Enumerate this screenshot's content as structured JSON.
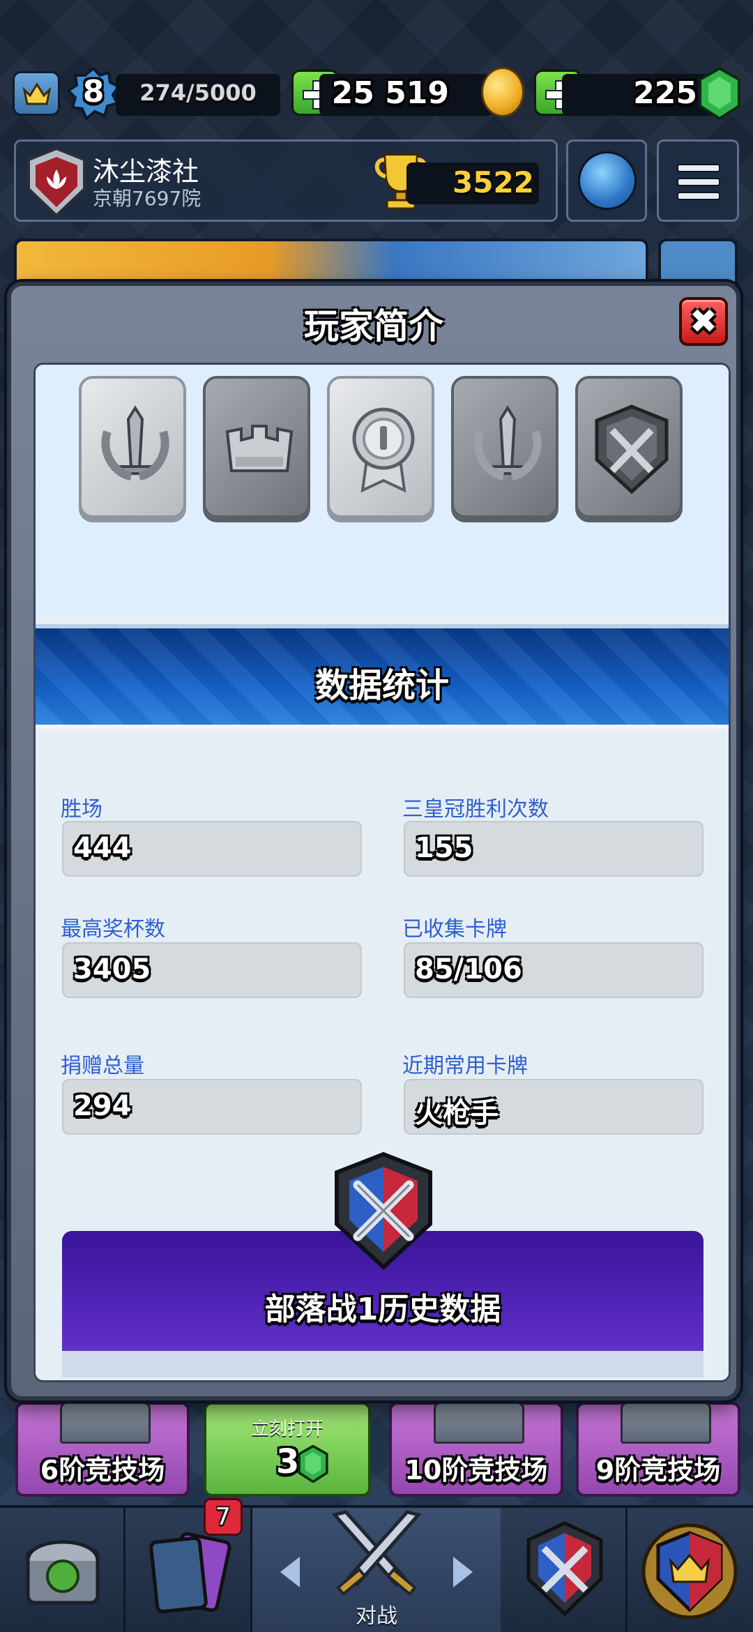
{
  "topbar": {
    "level": "8",
    "xp": "274/5000",
    "gold": "25 519",
    "gems": "225"
  },
  "clan": {
    "name": "沐尘漆社",
    "subtitle": "京朝7697院",
    "trophies": "3522"
  },
  "modal": {
    "title": "玩家简介",
    "close_label": "✖",
    "badges": [
      "sword-laurel-badge",
      "crown-badge",
      "medal-badge",
      "sword-laurel-badge",
      "clan-war-shield-badge"
    ],
    "section_title": "数据统计",
    "stats": {
      "wins_label": "胜场",
      "wins_value": "444",
      "three_crown_label": "三皇冠胜利次数",
      "three_crown_value": "155",
      "best_trophies_label": "最高奖杯数",
      "best_trophies_value": "3405",
      "cards_found_label": "已收集卡牌",
      "cards_found_value": "85/106",
      "donations_label": "捐赠总量",
      "donations_value": "294",
      "favorite_card_label": "近期常用卡牌",
      "favorite_card_value": "火枪手"
    },
    "clanwar_title": "部落战1历史数据"
  },
  "arenas": {
    "card1": "6阶竞技场",
    "open_label": "立刻打开",
    "open_cost": "3",
    "card3": "10阶竞技场",
    "card4": "9阶竞技场"
  },
  "nav": {
    "cards_badge": "7",
    "battle_label": "对战"
  },
  "colors": {
    "accent_blue": "#1462c8",
    "stat_label_blue": "#2f5ed0",
    "close_red": "#c81b1b",
    "clanwar_purple": "#3a149a"
  }
}
